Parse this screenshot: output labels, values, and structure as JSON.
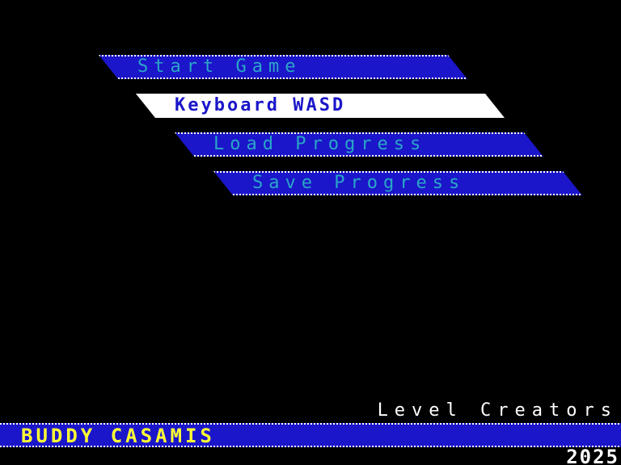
{
  "menu": {
    "items": [
      {
        "label": "Start Game",
        "selected": false
      },
      {
        "label": "Keyboard WASD",
        "selected": true
      },
      {
        "label": "Load Progress",
        "selected": false
      },
      {
        "label": "Save Progress",
        "selected": false
      }
    ]
  },
  "credits": {
    "title": "Level Creators",
    "name": "BUDDY CASAMIS",
    "year": "2025"
  },
  "colors": {
    "background": "#000000",
    "band_blue": "#1b16c9",
    "selected_band": "#ffffff",
    "menu_text": "#2aa6c8",
    "selected_text": "#1b16c9",
    "credit_name": "#ffff33",
    "credit_text": "#ffffff"
  }
}
